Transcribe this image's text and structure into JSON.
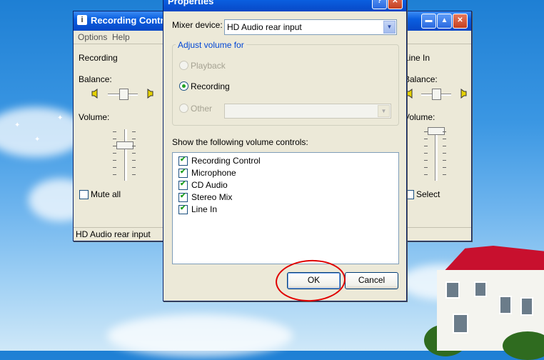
{
  "rec_control": {
    "title": "Recording Control",
    "menu": [
      "Options",
      "Help"
    ],
    "channels": [
      {
        "name": "Recording",
        "balance_label": "Balance:",
        "volume_label": "Volume:",
        "toggle_label": "Mute all",
        "toggle_checked": false
      },
      {
        "name": "Line In",
        "balance_label": "Balance:",
        "volume_label": "Volume:",
        "toggle_label": "Select",
        "toggle_checked": false
      }
    ],
    "status": "HD Audio rear input",
    "icons": [
      "window-menu-icon",
      "minimize-icon",
      "maximize-icon",
      "close-icon",
      "speaker-left-icon",
      "speaker-right-icon"
    ]
  },
  "properties": {
    "title": "Properties",
    "mixer_device_label": "Mixer device:",
    "mixer_device_value": "HD Audio rear input",
    "adjust_group_label": "Adjust volume for",
    "radios": [
      {
        "label": "Playback",
        "selected": false,
        "enabled": false
      },
      {
        "label": "Recording",
        "selected": true,
        "enabled": true
      },
      {
        "label": "Other",
        "selected": false,
        "enabled": false
      }
    ],
    "show_label": "Show the following volume controls:",
    "controls": [
      {
        "label": "Recording Control",
        "checked": true
      },
      {
        "label": "Microphone",
        "checked": true
      },
      {
        "label": "CD Audio",
        "checked": true
      },
      {
        "label": "Stereo Mix",
        "checked": true
      },
      {
        "label": "Line In",
        "checked": true
      }
    ],
    "ok_label": "OK",
    "cancel_label": "Cancel",
    "annotation_color": "#e00000"
  }
}
